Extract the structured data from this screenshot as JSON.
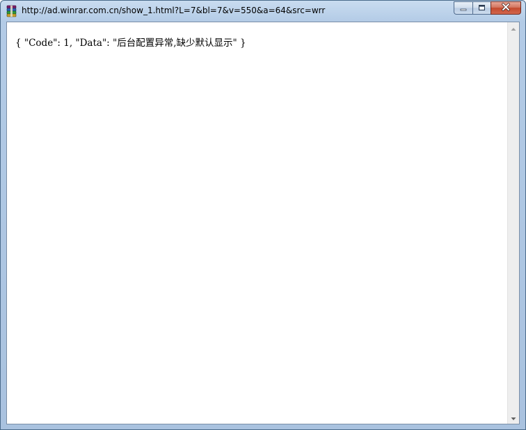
{
  "window": {
    "title": "http://ad.winrar.com.cn/show_1.html?L=7&bl=7&v=550&a=64&src=wrr",
    "app_icon": "winrar-icon",
    "controls": {
      "minimize": "minimize-icon",
      "maximize": "maximize-icon",
      "close": "close-icon"
    }
  },
  "content": {
    "text": "{ \"Code\": 1, \"Data\": \"后台配置异常,缺少默认显示\" }"
  },
  "scrollbar": {
    "up_icon": "scroll-up-arrow-icon",
    "down_icon": "scroll-down-arrow-icon"
  }
}
